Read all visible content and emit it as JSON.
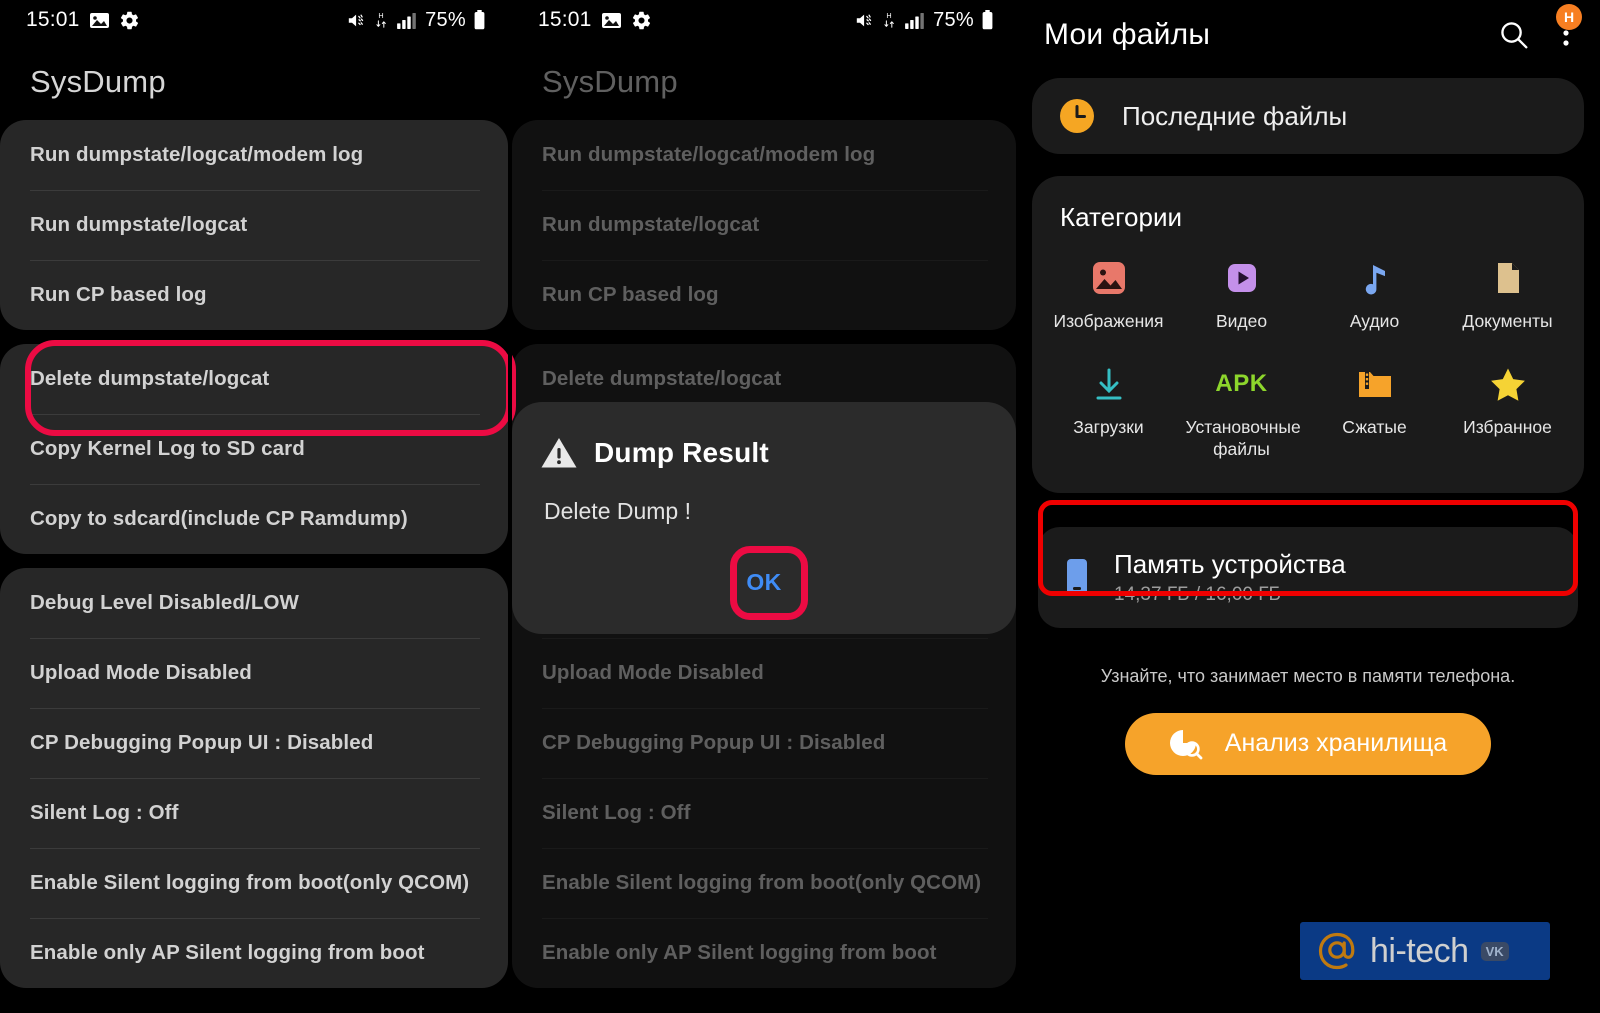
{
  "statusbar": {
    "time": "15:01",
    "battery_percent": "75%",
    "icons": [
      "image-icon",
      "gear-icon",
      "mute-icon",
      "hsdpa-icon",
      "signal-icon",
      "battery-icon"
    ]
  },
  "panel1": {
    "app_title": "SysDump",
    "groups": [
      {
        "items": [
          "Run dumpstate/logcat/modem log",
          "Run dumpstate/logcat",
          "Run CP based log"
        ]
      },
      {
        "items": [
          "Delete dumpstate/logcat",
          "Copy Kernel Log to SD card",
          "Copy to sdcard(include CP Ramdump)"
        ]
      },
      {
        "items": [
          "Debug Level Disabled/LOW",
          "Upload Mode Disabled",
          "CP Debugging Popup UI : Disabled",
          "Silent Log : Off",
          "Enable Silent logging from boot(only QCOM)",
          "Enable only AP Silent logging from boot"
        ]
      }
    ],
    "highlight_color": "#ec0b43",
    "highlighted_item": "Delete dumpstate/logcat"
  },
  "panel2": {
    "app_title": "SysDump",
    "dialog": {
      "icon": "warning-triangle-icon",
      "title": "Dump Result",
      "message": "Delete Dump !",
      "ok_label": "OK",
      "ok_color": "#3f8cf6",
      "highlight_color": "#ec0b43"
    }
  },
  "panel3": {
    "title": "Мои файлы",
    "search_icon": "search-icon",
    "menu_icon": "more-vertical-icon",
    "account_badge": "H",
    "recent": {
      "label": "Последние файлы",
      "icon": "clock-icon",
      "icon_color": "#f5a623"
    },
    "categories": {
      "title": "Категории",
      "items": [
        {
          "label": "Изображения",
          "icon": "image-icon",
          "color": "#e8786a"
        },
        {
          "label": "Видео",
          "icon": "video-play-icon",
          "color": "#c490ea"
        },
        {
          "label": "Аудио",
          "icon": "music-note-icon",
          "color": "#7aa7f0"
        },
        {
          "label": "Документы",
          "icon": "document-icon",
          "color": "#ddc18e"
        },
        {
          "label": "Загрузки",
          "icon": "download-icon",
          "color": "#35bfc4"
        },
        {
          "label": "Установочные файлы",
          "icon": "apk-icon",
          "color": "#8dd62c"
        },
        {
          "label": "Сжатые",
          "icon": "folder-icon",
          "color": "#f6a32a"
        },
        {
          "label": "Избранное",
          "icon": "star-icon",
          "color": "#f5d335"
        }
      ]
    },
    "storage": {
      "name": "Память устройства",
      "size": "14,37 ГБ / 16,00 ГБ",
      "icon": "phone-icon",
      "icon_color": "#6d9eeb",
      "highlight_color": "#ef0000"
    },
    "hint": "Узнайте, что занимает место в памяти телефона.",
    "analyze_button": {
      "label": "Анализ хранилища",
      "icon": "storage-analysis-icon",
      "color": "#f6a32a"
    }
  },
  "watermark": {
    "text": "hi-tech",
    "badge": "VK",
    "bg": "#0b3a85",
    "at_icon": "at-icon"
  }
}
